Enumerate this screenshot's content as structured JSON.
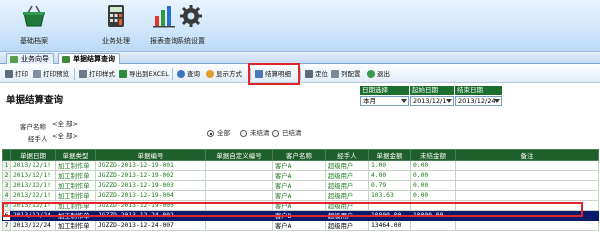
{
  "topbar": {
    "buttons": [
      {
        "label": "基础档案",
        "icon": "basket-icon"
      },
      {
        "label": "业务处理",
        "icon": "calculator-icon"
      },
      {
        "label": "报表查询",
        "icon": "bar-chart-icon"
      },
      {
        "label": "系统设置",
        "icon": "gear-icon"
      }
    ]
  },
  "tabs": [
    "业务向导",
    "单据结算查询"
  ],
  "toolbar": {
    "print": "打印",
    "print_preview": "打印预览",
    "print_style": "打印样式",
    "export_excel": "导出到EXCEL",
    "query": "查询",
    "display_mode": "显示方式",
    "settle_detail": "结算明细",
    "locate": "定位",
    "column_config": "列配置",
    "exit": "退出"
  },
  "page_title": "单据结算查询",
  "date_filter": {
    "headers": [
      "日期选择",
      "起始日期",
      "结束日期"
    ],
    "values": [
      "本月",
      "2013/12/1",
      "2013/12/24"
    ]
  },
  "filters": {
    "customer_label": "客户名称",
    "customer_value": "<全  部>",
    "handler_label": "经手人",
    "handler_value": "<全  部>",
    "radios": [
      "全部",
      "未结清",
      "已结清"
    ]
  },
  "table": {
    "columns": [
      "单据日期",
      "单据类型",
      "单据编号",
      "单据自定义编号",
      "客户名称",
      "经手人",
      "单据金额",
      "未结金额",
      "备注"
    ],
    "rows": [
      {
        "n": "1",
        "cells": [
          "2013/12/1!",
          "加工制作单",
          "JGZZD-2013-12-19-001",
          "",
          "客户A",
          "超级用户",
          "1.00",
          "0.00",
          ""
        ]
      },
      {
        "n": "2",
        "cells": [
          "2013/12/1!",
          "加工制作单",
          "JGZZD-2013-12-19-002",
          "",
          "客户A",
          "超级用户",
          "4.00",
          "0.00",
          ""
        ]
      },
      {
        "n": "3",
        "cells": [
          "2013/12/1!",
          "加工制作单",
          "JGZZD-2013-12-19-003",
          "",
          "客户A",
          "超级用户",
          "0.79",
          "0.00",
          ""
        ]
      },
      {
        "n": "4",
        "cells": [
          "2013/12/1!",
          "加工制作单",
          "JGZZD-2013-12-19-004",
          "",
          "客户A",
          "超级用户",
          "103.63",
          "0.00",
          ""
        ]
      },
      {
        "n": "5",
        "cells": [
          "2013/12/1!",
          "加工制作单",
          "JGZZD-2013-12-19-005",
          "",
          "客户A",
          "超级用户",
          "",
          "",
          ""
        ]
      },
      {
        "n": "6",
        "cells": [
          "2013/12/24",
          "加工制作单",
          "JGZZD-2013-12-24-002",
          "",
          "客户B",
          "超级用户",
          "10800.00",
          "10000.00",
          ""
        ]
      },
      {
        "n": "7",
        "cells": [
          "2013/12/24",
          "加工制作单",
          "JGZZD-2013-12-24-007",
          "",
          "客户A",
          "超级用户",
          "13464.00",
          "",
          ""
        ]
      }
    ]
  }
}
